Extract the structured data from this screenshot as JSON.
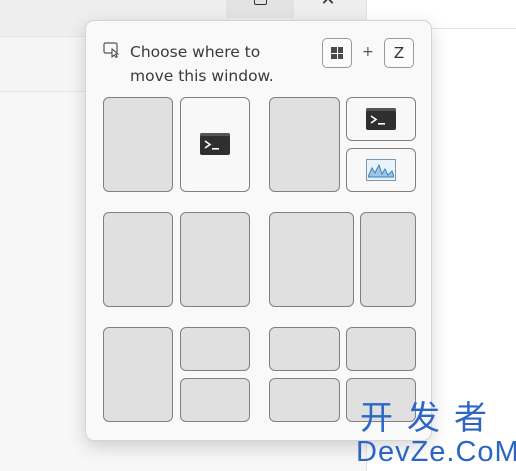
{
  "flyout": {
    "prompt": "Choose where to move this window.",
    "shortcut": {
      "key1_icon": "windows-logo-icon",
      "plus": "+",
      "key2": "Z"
    },
    "layouts": [
      {
        "name": "two-halves",
        "zones": 2,
        "filled_zone_icons": [
          "terminal-icon"
        ]
      },
      {
        "name": "half-and-two-quarters",
        "zones": 3,
        "filled_zone_icons": [
          "terminal-icon",
          "performance-monitor-icon"
        ]
      },
      {
        "name": "two-halves-alt",
        "zones": 2,
        "filled_zone_icons": []
      },
      {
        "name": "wide-and-narrow",
        "zones": 2,
        "filled_zone_icons": []
      },
      {
        "name": "half-and-two-stacked",
        "zones": 3,
        "filled_zone_icons": []
      },
      {
        "name": "four-quarters",
        "zones": 4,
        "filled_zone_icons": []
      }
    ]
  },
  "background_window": {
    "controls": [
      "maximize-icon",
      "close-icon"
    ],
    "close_glyph": "✕"
  },
  "watermark": {
    "line1": "开发者",
    "line2": "DevZe.CoM"
  }
}
